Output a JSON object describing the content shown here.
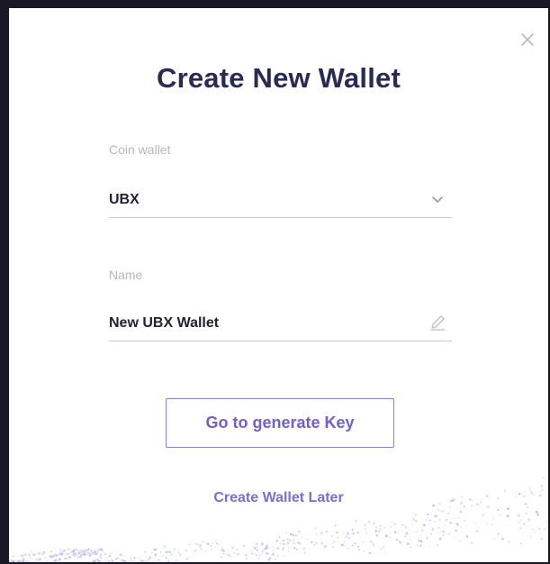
{
  "dialog": {
    "title": "Create New Wallet",
    "close_icon": "close-icon",
    "coin_field": {
      "label": "Coin wallet",
      "selected_value": "UBX",
      "icon": "chevron-down-icon"
    },
    "name_field": {
      "label": "Name",
      "value": "New UBX Wallet",
      "icon": "pencil-icon"
    },
    "generate_button_label": "Go to generate Key",
    "later_link_label": "Create Wallet Later"
  },
  "colors": {
    "title": "#2b2a55",
    "accent": "#7b6fd4",
    "button_border": "#8a80d9",
    "label": "#b7b7bd",
    "underline": "#c9c8d6"
  }
}
